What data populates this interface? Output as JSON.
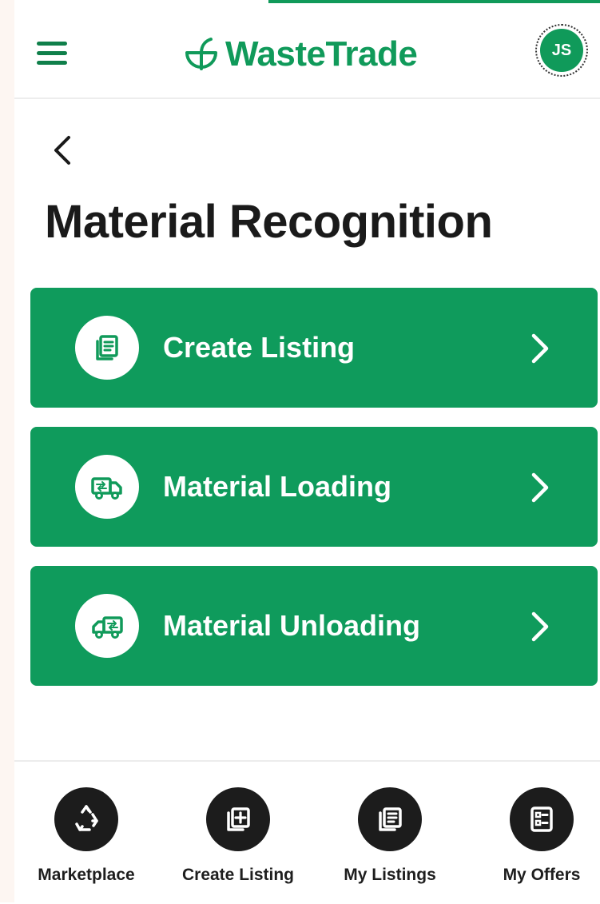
{
  "app": {
    "brand": "WasteTrade",
    "avatar_initials": "JS",
    "accent_color": "#109a5a",
    "dark_icon_color": "#1c1c1c"
  },
  "page": {
    "title": "Material Recognition",
    "back_icon": "chevron-left-icon"
  },
  "actions": [
    {
      "label": "Create Listing",
      "icon": "listing-document-icon"
    },
    {
      "label": "Material Loading",
      "icon": "truck-loading-icon"
    },
    {
      "label": "Material Unloading",
      "icon": "truck-unloading-icon"
    }
  ],
  "bottom_nav": [
    {
      "label": "Marketplace",
      "icon": "recycle-icon"
    },
    {
      "label": "Create Listing",
      "icon": "add-listing-icon"
    },
    {
      "label": "My Listings",
      "icon": "listings-icon"
    },
    {
      "label": "My Offers",
      "icon": "offers-icon"
    }
  ]
}
